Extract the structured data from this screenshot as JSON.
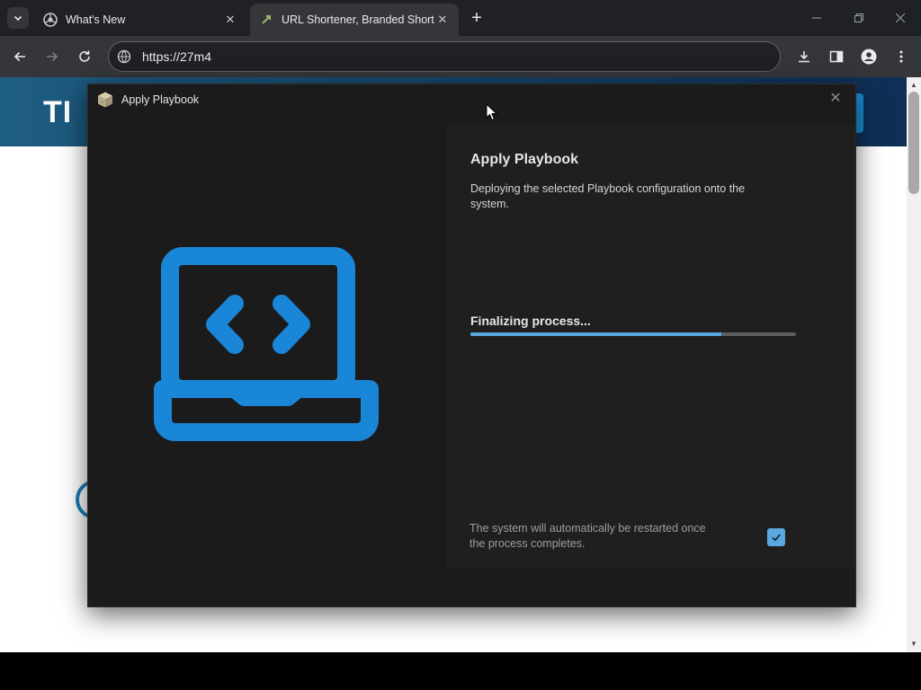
{
  "browser": {
    "tabs": [
      {
        "label": "What's New",
        "active": false
      },
      {
        "label": "URL Shortener, Branded Short Links",
        "active": true
      }
    ],
    "url": "https://27m4",
    "new_tab_symbol": "+",
    "close_symbol": "✕"
  },
  "page": {
    "logo_text": "TI"
  },
  "dialog": {
    "title": "Apply Playbook",
    "close_symbol": "✕",
    "heading": "Apply Playbook",
    "description": "Deploying the selected Playbook configuration onto the system.",
    "status": "Finalizing process...",
    "progress": 0.77,
    "note": "The system will automatically be restarted once the process completes.",
    "restart_checked": true,
    "hero_icon": "laptop-code-icon"
  },
  "colors": {
    "accent": "#5aa8e0",
    "hero_blue": "#1a86d8",
    "dialog_bg": "#1b1b1b",
    "pane_bg": "#1f1f1f"
  }
}
